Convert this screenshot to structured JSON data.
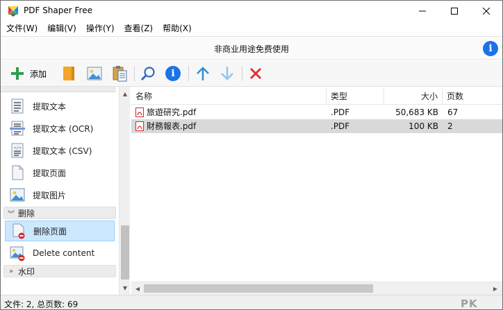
{
  "window": {
    "title": "PDF Shaper Free",
    "controls": {
      "minimize": "minimize",
      "maximize": "maximize",
      "close": "close"
    }
  },
  "menu": [
    "文件(W)",
    "编辑(V)",
    "操作(Y)",
    "查看(Z)",
    "帮助(X)"
  ],
  "banner": {
    "text": "非商业用途免费使用",
    "info_icon": "i"
  },
  "toolbar": {
    "add_label": "添加",
    "info_icon": "i",
    "icons": [
      "plus-icon",
      "file-icon",
      "image-icon",
      "clipboard-icon",
      "search-icon",
      "info-icon",
      "arrow-up-icon",
      "arrow-down-icon",
      "delete-x-icon"
    ]
  },
  "left_panel": {
    "extract_items": [
      {
        "label": "提取文本",
        "icon": "text-doc-icon"
      },
      {
        "label": "提取文本 (OCR)",
        "icon": "ocr-scan-icon"
      },
      {
        "label": "提取文本 (CSV)",
        "icon": "csv-doc-icon"
      },
      {
        "label": "提取页面",
        "icon": "page-icon"
      },
      {
        "label": "提取图片",
        "icon": "image-icon"
      }
    ],
    "category_delete": "删除",
    "delete_items": [
      {
        "label": "删除页面",
        "icon": "delete-page-icon",
        "selected": true
      },
      {
        "label": "Delete content",
        "icon": "delete-content-icon",
        "selected": false
      }
    ],
    "category_watermark": "水印"
  },
  "file_list": {
    "columns": {
      "name": "名称",
      "type": "类型",
      "size": "大小",
      "pages": "页数"
    },
    "rows": [
      {
        "name": "旅遊研究.pdf",
        "type": ".PDF",
        "size": "50,683 KB",
        "pages": "67",
        "selected": false
      },
      {
        "name": "財務報表.pdf",
        "type": ".PDF",
        "size": "100 KB",
        "pages": "2",
        "selected": true
      }
    ]
  },
  "status": {
    "text": "文件: 2, 总页数: 69"
  },
  "watermark": "PK",
  "colors": {
    "accent_blue": "#1a73e8",
    "add_green": "#2e9e4e",
    "delete_red": "#e03030",
    "arrow_blue": "#2f8fd8",
    "arrow_light_blue": "#8fc6ee",
    "file_orange": "#f2a52a",
    "pdf_red": "#d9262b",
    "selection": "#cce8ff"
  }
}
